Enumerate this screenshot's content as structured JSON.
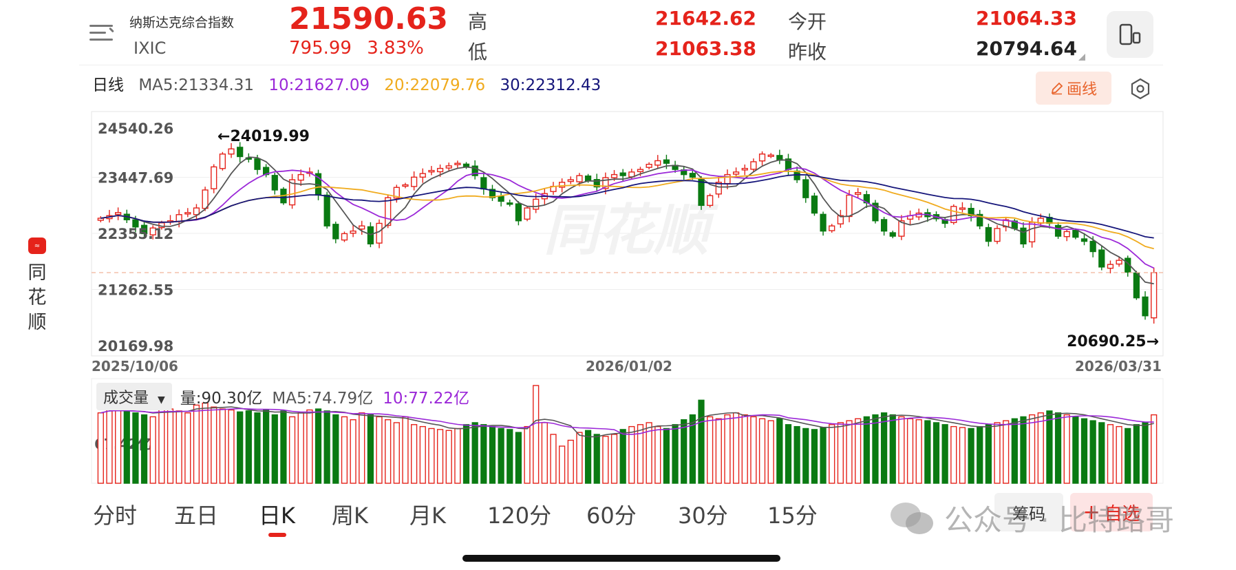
{
  "sidebar": {
    "brand_chars": [
      "同",
      "花",
      "顺"
    ]
  },
  "header": {
    "index_name": "纳斯达克综合指数",
    "index_code": "IXIC",
    "price": "21590.63",
    "change": "795.99",
    "change_pct": "3.83%",
    "high_label": "高",
    "high_value": "21642.62",
    "low_label": "低",
    "low_value": "21063.38",
    "open_label": "今开",
    "open_value": "21064.33",
    "prev_close_label": "昨收",
    "prev_close_value": "20794.64"
  },
  "ma_legend": {
    "period": "日线",
    "ma5": "MA5:21334.31",
    "ma10": "10:21627.09",
    "ma20": "20:22079.76",
    "ma30": "30:22312.43"
  },
  "toolbar": {
    "draw_label": "画线",
    "settings_icon": "hexagon-gear-icon"
  },
  "colors": {
    "up": "#e5231b",
    "down": "#0a7a12",
    "ma5": "#555555",
    "ma10": "#9b28d8",
    "ma20": "#f0ab1e",
    "ma30": "#15157a"
  },
  "chart_data": {
    "type": "candlestick",
    "watermark": "同花顺",
    "y_ticks": [
      "24540.26",
      "23447.69",
      "22355.12",
      "21262.55",
      "20169.98"
    ],
    "y_range": [
      20169.98,
      24540.26
    ],
    "x_labels": [
      "2025/10/06",
      "2026/01/02",
      "2026/03/31"
    ],
    "max_annotation": "←24019.99",
    "min_annotation": "20690.25→",
    "max_value": 24019.99,
    "min_value": 20690.25,
    "last_close": 21590.63,
    "closes": [
      22650,
      22700,
      22760,
      22620,
      22480,
      22350,
      22460,
      22560,
      22600,
      22720,
      22760,
      22850,
      23200,
      23650,
      23900,
      24000,
      23850,
      23800,
      23600,
      23500,
      23200,
      22950,
      23400,
      23500,
      23550,
      23100,
      22500,
      22250,
      22350,
      22400,
      22500,
      22150,
      22550,
      23050,
      23250,
      23300,
      23450,
      23520,
      23580,
      23620,
      23670,
      23720,
      23650,
      23480,
      23220,
      23050,
      22980,
      22930,
      22600,
      22850,
      23020,
      23130,
      23270,
      23350,
      23400,
      23480,
      23380,
      23260,
      23440,
      23500,
      23480,
      23550,
      23600,
      23700,
      23770,
      23720,
      23600,
      23500,
      23450,
      22900,
      23090,
      23350,
      23500,
      23550,
      23620,
      23750,
      23900,
      23880,
      23780,
      23600,
      23400,
      23050,
      22750,
      22400,
      22500,
      22700,
      23100,
      23150,
      22950,
      22600,
      22400,
      22300,
      22600,
      22700,
      22750,
      22680,
      22640,
      22550,
      22880,
      22850,
      22700,
      22500,
      22200,
      22450,
      22620,
      22450,
      22150,
      22570,
      22650,
      22550,
      22300,
      22390,
      22280,
      22200,
      22000,
      21700,
      21750,
      21830,
      21600,
      21100,
      20750,
      21590
    ],
    "volume": {
      "title": "成交量",
      "dropdown_icon": "caret-down-icon",
      "vol_label": "量:90.30亿",
      "ma5_label": "MA5:74.79亿",
      "ma10_label": "10:77.22亿",
      "y_tick": "67.42亿",
      "values": [
        72,
        76,
        75,
        74,
        72,
        70,
        68,
        78,
        76,
        74,
        72,
        80,
        82,
        78,
        76,
        75,
        73,
        74,
        72,
        75,
        70,
        74,
        68,
        72,
        75,
        76,
        74,
        70,
        68,
        65,
        72,
        70,
        68,
        65,
        62,
        68,
        60,
        58,
        56,
        55,
        54,
        56,
        60,
        62,
        60,
        58,
        56,
        55,
        52,
        58,
        100,
        62,
        50,
        38,
        44,
        52,
        54,
        50,
        48,
        50,
        55,
        58,
        60,
        62,
        58,
        56,
        60,
        65,
        70,
        85,
        68,
        66,
        70,
        72,
        70,
        68,
        66,
        64,
        66,
        60,
        58,
        56,
        55,
        57,
        60,
        62,
        64,
        66,
        68,
        70,
        72,
        70,
        68,
        66,
        65,
        64,
        62,
        60,
        58,
        57,
        56,
        58,
        60,
        62,
        64,
        66,
        68,
        70,
        72,
        74,
        72,
        70,
        68,
        66,
        64,
        62,
        60,
        58,
        56,
        60,
        62,
        70
      ]
    }
  },
  "tabs": {
    "items": [
      "分时",
      "五日",
      "日K",
      "周K",
      "月K",
      "120分",
      "60分",
      "30分",
      "15分"
    ],
    "active_index": 2,
    "chip_left": "筹码",
    "chip_right_icon": "plus-icon",
    "chip_right": "自选"
  },
  "watermark_text": "公众号 · 比特路哥"
}
